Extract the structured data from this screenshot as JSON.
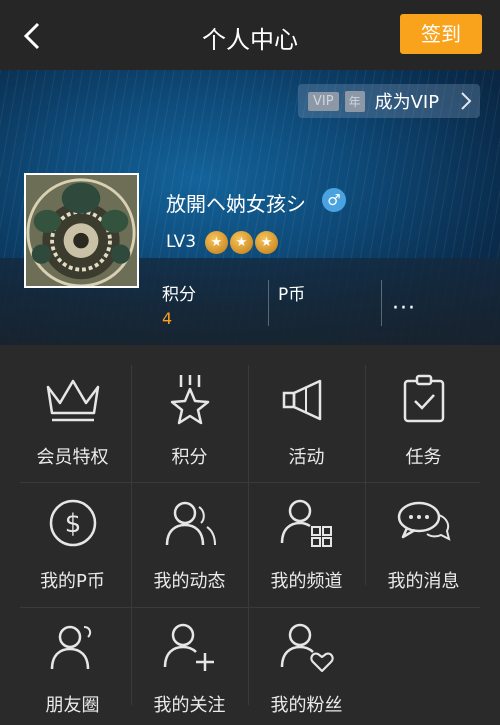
{
  "header": {
    "title": "个人中心",
    "checkin_label": "签到"
  },
  "vip": {
    "tag_vip": "VIP",
    "tag_year": "年",
    "label": "成为VIP"
  },
  "profile": {
    "username": "放開ヘ妠女孩シ",
    "gender": "♂",
    "level": "LV3",
    "stars": 3
  },
  "stats": [
    {
      "label": "积分",
      "value": "4"
    },
    {
      "label": "P币",
      "value": ""
    },
    {
      "label": "···"
    }
  ],
  "menu": [
    {
      "label": "会员特权",
      "icon": "crown-icon"
    },
    {
      "label": "积分",
      "icon": "star-points-icon"
    },
    {
      "label": "活动",
      "icon": "megaphone-icon"
    },
    {
      "label": "任务",
      "icon": "clipboard-check-icon"
    },
    {
      "label": "我的P币",
      "icon": "coin-icon"
    },
    {
      "label": "我的动态",
      "icon": "users-icon"
    },
    {
      "label": "我的频道",
      "icon": "user-grid-icon"
    },
    {
      "label": "我的消息",
      "icon": "chat-bubbles-icon"
    },
    {
      "label": "朋友圈",
      "icon": "friends-icon"
    },
    {
      "label": "我的关注",
      "icon": "user-plus-icon"
    },
    {
      "label": "我的粉丝",
      "icon": "user-heart-icon"
    }
  ],
  "colors": {
    "accent": "#f9a21b",
    "background": "#2a2a2a",
    "topbar": "#262626"
  }
}
